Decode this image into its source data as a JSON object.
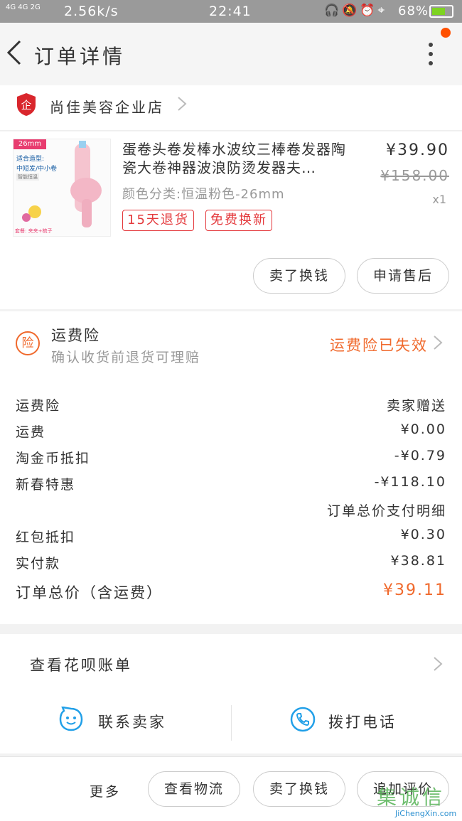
{
  "status_bar": {
    "network": "4G 4G 2G",
    "speed": "2.56k/s",
    "time": "22:41",
    "icons": [
      "headset-icon",
      "mute-bell-icon",
      "alarm-icon",
      "location-icon"
    ],
    "battery": "68%",
    "battery_level": 0.68,
    "battery_color": "#7ed321"
  },
  "header": {
    "title": "订单详情",
    "notify_color": "#ff5000"
  },
  "store": {
    "name": "尚佳美容企业店",
    "badge_char": "企"
  },
  "product": {
    "image_texts": {
      "size_tag": "26mm",
      "line1": "适合造型:",
      "line2": "中短发/中小卷",
      "line3": "智能恒温",
      "line4": "套餐: 夹夹+梳子"
    },
    "title": "蛋卷头卷发棒水波纹三棒卷发器陶瓷大卷神器波浪防烫发器夫…",
    "spec": "颜色分类:恒温粉色-26mm",
    "price": "¥39.90",
    "original_price": "¥158.00",
    "qty": "x1",
    "chips": [
      "15天退货",
      "免费换新"
    ],
    "buttons": [
      "卖了换钱",
      "申请售后"
    ]
  },
  "freight_insurance": {
    "icon_char": "险",
    "title": "运费险",
    "subtitle": "确认收货前退货可理赔",
    "status": "运费险已失效",
    "accent": "#f0692c"
  },
  "summary": {
    "rows": [
      {
        "label": "运费险",
        "value": "卖家赠送"
      },
      {
        "label": "运费",
        "value": "¥0.00"
      },
      {
        "label": "淘金币抵扣",
        "value": "-¥0.79"
      },
      {
        "label": "新春特惠",
        "value": "-¥118.10"
      },
      {
        "label": "",
        "value": "订单总价支付明细"
      },
      {
        "label": "红包抵扣",
        "value": "¥0.30"
      },
      {
        "label": "实付款",
        "value": "¥38.81"
      }
    ],
    "total_label": "订单总价（含运费）",
    "total_value": "¥39.11"
  },
  "huabei": {
    "label": "查看花呗账单",
    "contact_seller": "联系卖家",
    "call_phone": "拨打电话"
  },
  "bottom_bar": {
    "more": "更多",
    "buttons": [
      "查看物流",
      "卖了换钱",
      "追加评价"
    ]
  },
  "watermark": {
    "text": "集诚信",
    "url_text": "JiChengXin.com"
  }
}
